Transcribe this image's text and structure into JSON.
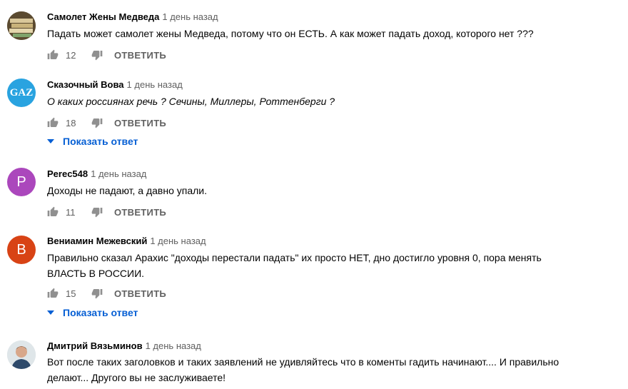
{
  "colors": {
    "link": "#065fd4",
    "meta": "#606060",
    "text": "#030303"
  },
  "reply_label": "ОТВЕТИТЬ",
  "comments": [
    {
      "author": "Самолет Жены Медведа",
      "time": "1 день назад",
      "text": "Падать может самолет жены Медведа, потому что он ЕСТЬ. А как может падать доход, которого нет ???",
      "likes": "12",
      "avatar": {
        "type": "image",
        "icon": "money-stack-avatar"
      }
    },
    {
      "author": "Сказочный Вова",
      "time": "1 день назад",
      "text": "О каких россиянах речь ? Сечины, Миллеры, Роттенберги ?",
      "likes": "18",
      "avatar": {
        "type": "text",
        "letter": "GAZ",
        "color": "#29a3e0"
      },
      "show_replies": "Показать ответ"
    },
    {
      "author": "Perec548",
      "time": "1 день назад",
      "text": "Доходы не падают, а давно упали.",
      "likes": "11",
      "avatar": {
        "type": "text",
        "letter": "P",
        "color": "#ab47bc"
      }
    },
    {
      "author": "Вениамин Межевский",
      "time": "1 день назад",
      "text": "Правильно сказал Арахис \"доходы перестали падать\" их просто НЕТ,  дно достигло уровня 0, пора менять ВЛАСТЬ В РОССИИ.",
      "likes": "15",
      "avatar": {
        "type": "text",
        "letter": "B",
        "color": "#d84315"
      },
      "show_replies": "Показать ответ"
    },
    {
      "author": "Дмитрий Вязьминов",
      "time": "1 день назад",
      "text": "Вот после таких заголовков и таких заявлений не удивляйтесь что в коменты гадить начинают.... И правильно делают... Другого вы не заслуживаете!",
      "avatar": {
        "type": "image",
        "icon": "person-photo-avatar"
      }
    }
  ]
}
